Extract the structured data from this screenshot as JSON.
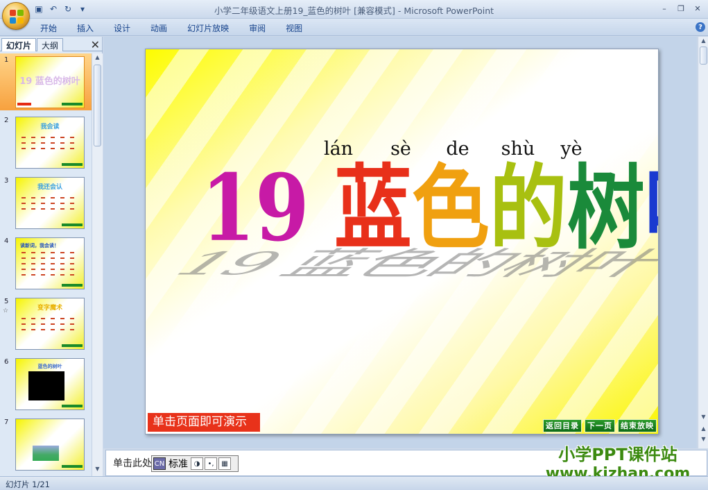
{
  "window": {
    "title": "小学二年级语文上册19_蓝色的树叶 [兼容模式] - Microsoft PowerPoint",
    "qat_icons": [
      "save-icon",
      "undo-icon",
      "redo-icon",
      "customize-icon"
    ],
    "qat_glyphs": [
      "▣",
      "↶",
      "↻",
      "▾"
    ],
    "controls": [
      "–",
      "❐",
      "✕"
    ]
  },
  "ribbon": {
    "tabs": [
      "开始",
      "插入",
      "设计",
      "动画",
      "幻灯片放映",
      "审阅",
      "视图"
    ],
    "help": "?"
  },
  "left_pane": {
    "tab_slides": "幻灯片",
    "tab_outline": "大纲",
    "close": "✕",
    "thumbnails": [
      {
        "number": "1",
        "title": "19 蓝色的树叶",
        "selected": true
      },
      {
        "number": "2",
        "title": "我会读"
      },
      {
        "number": "3",
        "title": "我还会认"
      },
      {
        "number": "4",
        "title": "读新词，我会读！"
      },
      {
        "number": "5",
        "title": "变字魔术",
        "star": "☆"
      },
      {
        "number": "6",
        "title": "蓝色的树叶"
      },
      {
        "number": "7",
        "title": ""
      }
    ]
  },
  "slide": {
    "pinyin": [
      "lán",
      "sè",
      "de",
      "shù",
      "yè"
    ],
    "title_number": "19",
    "title_chars": [
      "蓝",
      "色",
      "的",
      "树",
      "叶"
    ],
    "title_colors": [
      "#c71aa6",
      "#e8301a",
      "#f0a010",
      "#a8c010",
      "#1a8a3a",
      "#1a3ad0",
      "#8a1ad0"
    ],
    "click_hint": "单击页面即可演示",
    "nav_buttons": [
      "返回目录",
      "下一页",
      "结束放映"
    ]
  },
  "notes": {
    "text": "单击此处"
  },
  "ime": {
    "logo": "CN",
    "mode": "标准",
    "icons": [
      "◑",
      "•,",
      "▦"
    ]
  },
  "watermark": {
    "line1": "小学PPT课件站",
    "line2": "www.kjzhan.com"
  },
  "status": {
    "slide_counter": "幻灯片 1/21"
  }
}
